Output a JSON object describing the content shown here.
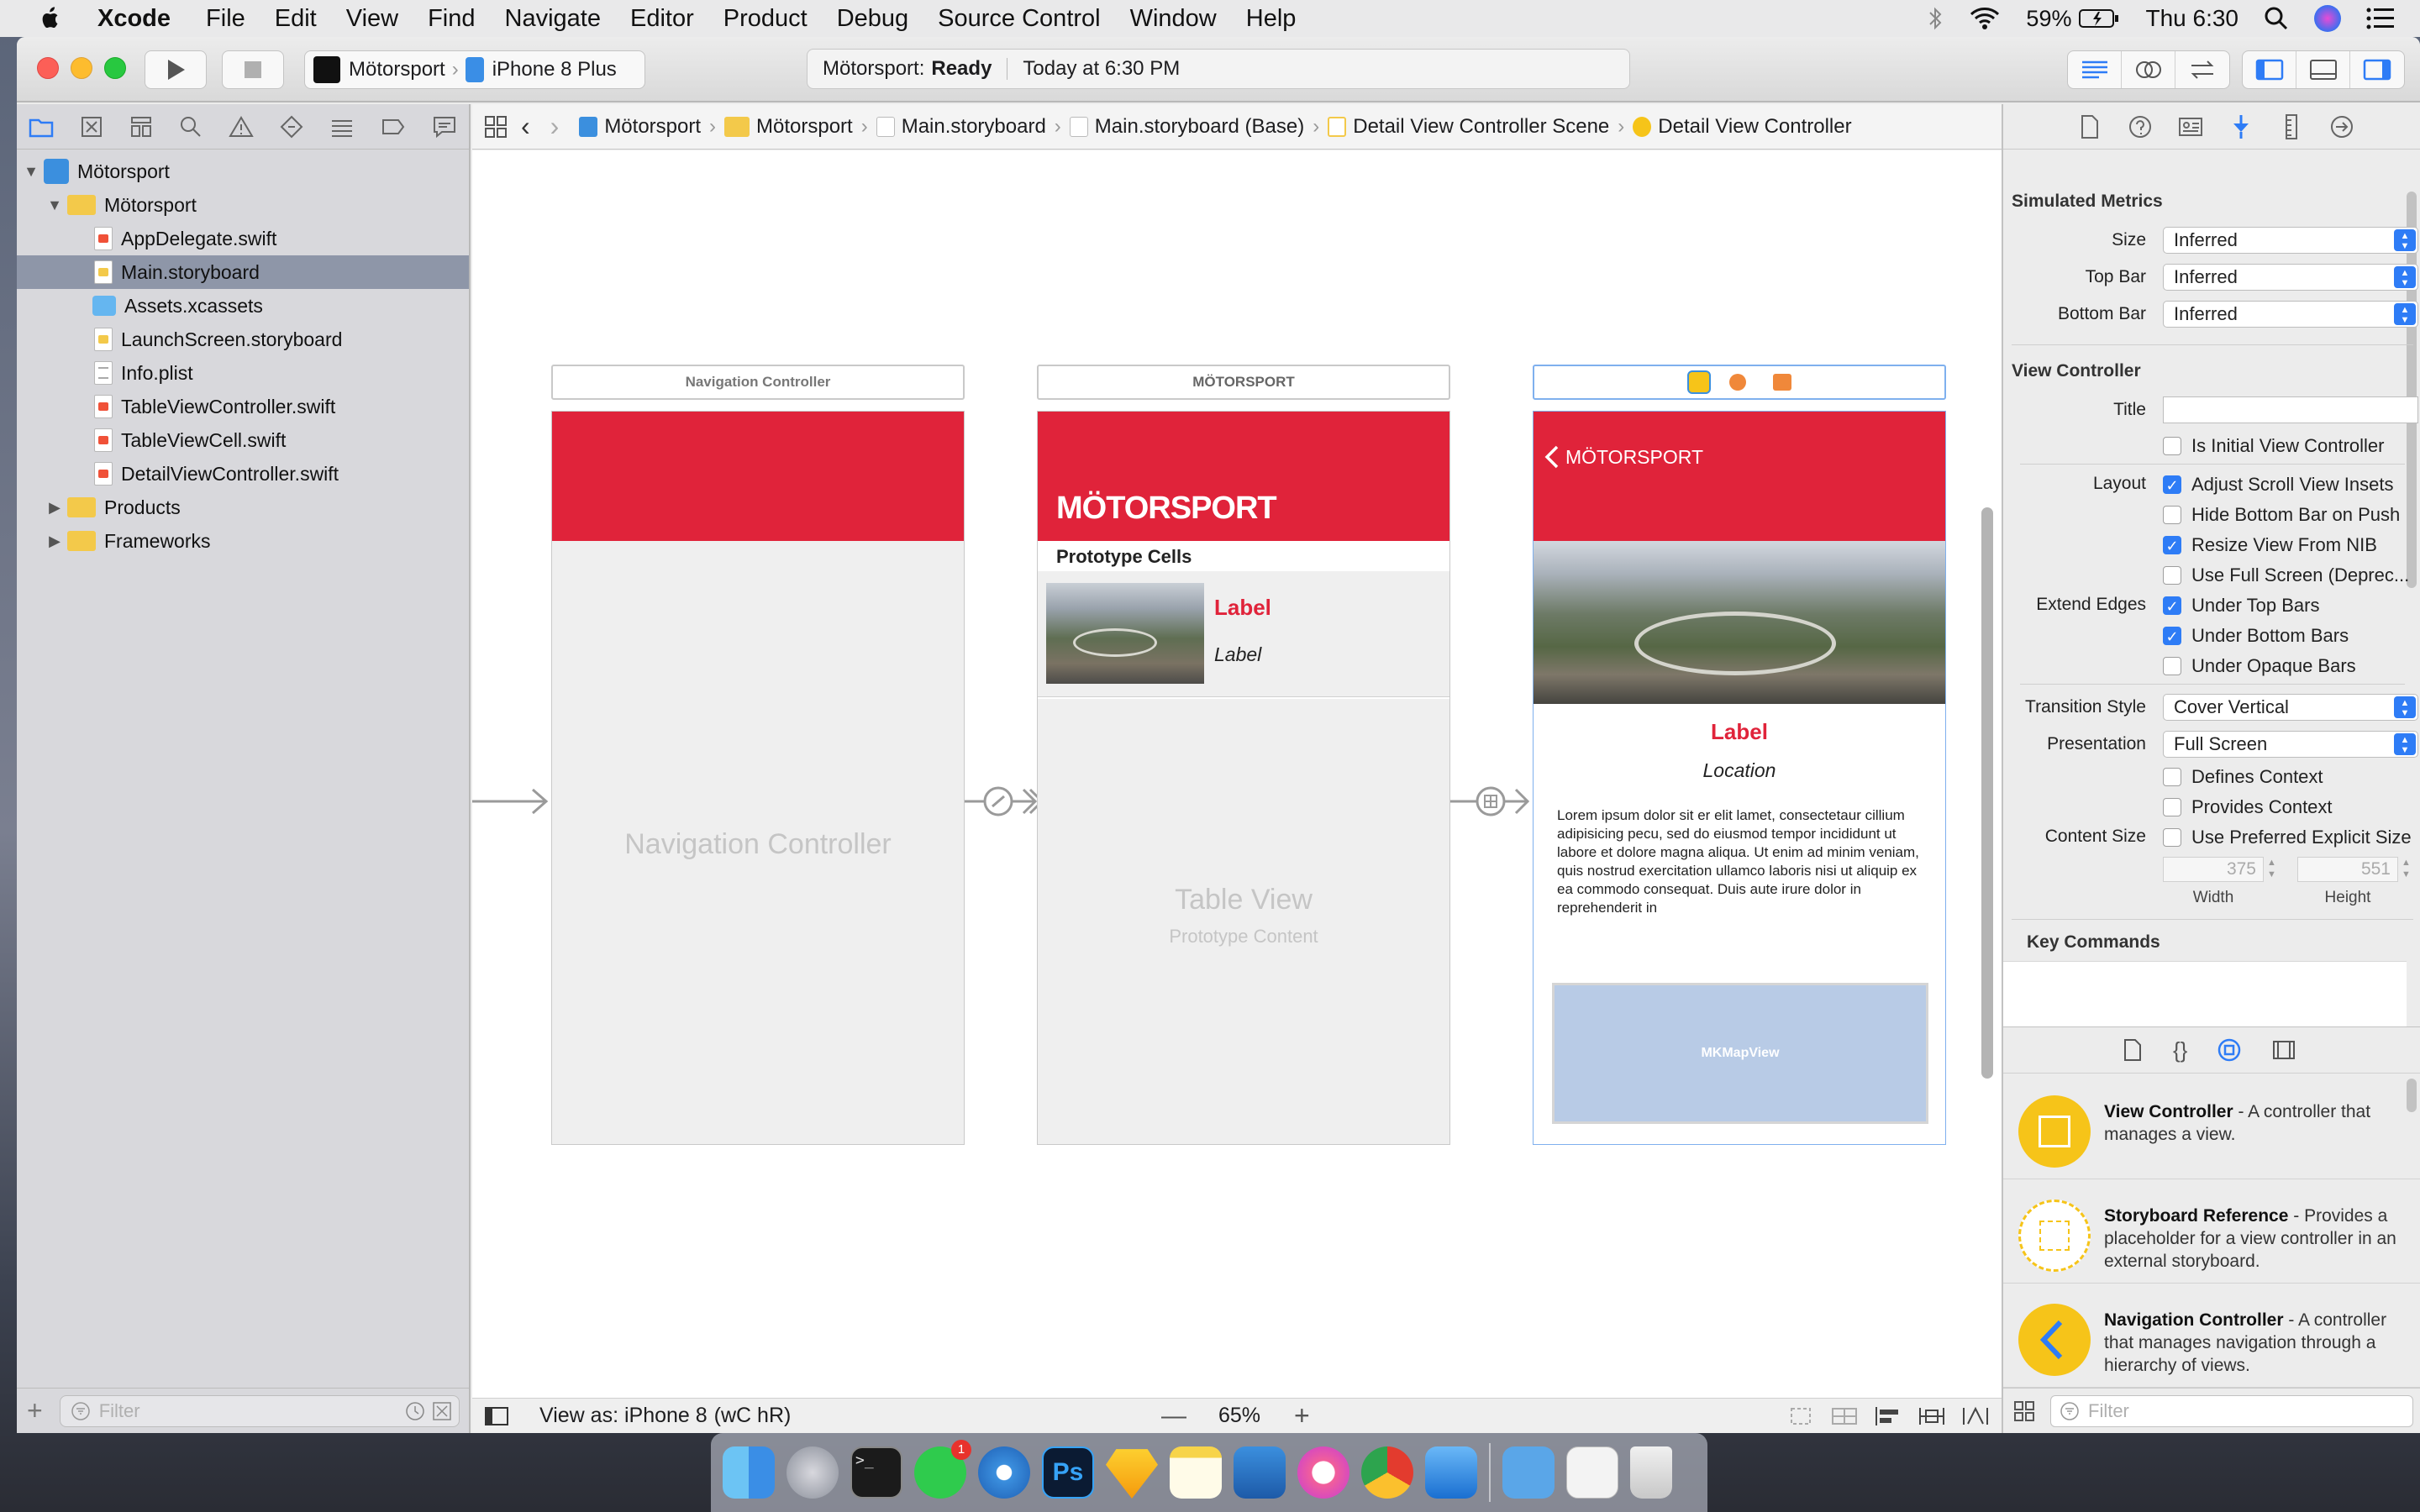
{
  "menubar": {
    "app_name": "Xcode",
    "items": [
      "File",
      "Edit",
      "View",
      "Find",
      "Navigate",
      "Editor",
      "Product",
      "Debug",
      "Source Control",
      "Window",
      "Help"
    ],
    "battery": "59%",
    "clock": "Thu 6:30"
  },
  "toolbar": {
    "scheme": "Mötorsport",
    "device": "iPhone 8 Plus",
    "activity_project": "Mötorsport:",
    "activity_status": "Ready",
    "activity_time": "Today at 6:30 PM"
  },
  "navigator": {
    "items": [
      {
        "label": "Mötorsport",
        "kind": "project"
      },
      {
        "label": "Mötorsport",
        "kind": "folder"
      },
      {
        "label": "AppDelegate.swift",
        "kind": "swift"
      },
      {
        "label": "Main.storyboard",
        "kind": "storyboard"
      },
      {
        "label": "Assets.xcassets",
        "kind": "assets"
      },
      {
        "label": "LaunchScreen.storyboard",
        "kind": "storyboard"
      },
      {
        "label": "Info.plist",
        "kind": "plist"
      },
      {
        "label": "TableViewController.swift",
        "kind": "swift"
      },
      {
        "label": "TableViewCell.swift",
        "kind": "swift"
      },
      {
        "label": "DetailViewController.swift",
        "kind": "swift"
      },
      {
        "label": "Products",
        "kind": "folder"
      },
      {
        "label": "Frameworks",
        "kind": "folder"
      }
    ],
    "filter_placeholder": "Filter"
  },
  "jumpbar": {
    "crumbs": [
      "Mötorsport",
      "Mötorsport",
      "Main.storyboard",
      "Main.storyboard (Base)",
      "Detail View Controller Scene",
      "Detail View Controller"
    ]
  },
  "storyboard": {
    "nav_scene_title": "Navigation Controller",
    "nav_placeholder": "Navigation Controller",
    "table_scene_title": "MÖTORSPORT",
    "table_large_title": "MÖTORSPORT",
    "prototype_cells": "Prototype Cells",
    "cell_title": "Label",
    "cell_subtitle": "Label",
    "table_view_text": "Table View",
    "prototype_content": "Prototype Content",
    "detail_back": "MÖTORSPORT",
    "detail_label": "Label",
    "detail_location": "Location",
    "detail_body": "Lorem ipsum dolor sit er elit lamet, consectetaur cillium adipisicing pecu, sed do eiusmod tempor incididunt ut labore et dolore magna aliqua. Ut enim ad minim veniam, quis nostrud exercitation ullamco laboris nisi ut aliquip ex ea commodo consequat. Duis aute irure dolor in reprehenderit in",
    "map_label": "MKMapView"
  },
  "editor_bottom": {
    "view_as": "View as: iPhone 8",
    "size_class": "(wC hR)",
    "zoom": "65%"
  },
  "inspector": {
    "simulated_metrics": "Simulated Metrics",
    "size_label": "Size",
    "size_value": "Inferred",
    "top_bar_label": "Top Bar",
    "top_bar_value": "Inferred",
    "bottom_bar_label": "Bottom Bar",
    "bottom_bar_value": "Inferred",
    "view_controller": "View Controller",
    "title_label": "Title",
    "initial_vc": "Is Initial View Controller",
    "layout_label": "Layout",
    "adjust_insets": "Adjust Scroll View Insets",
    "hide_bottom_bar": "Hide Bottom Bar on Push",
    "resize_nib": "Resize View From NIB",
    "full_screen": "Use Full Screen (Deprec...",
    "extend_edges_label": "Extend Edges",
    "under_top": "Under Top Bars",
    "under_bottom": "Under Bottom Bars",
    "under_opaque": "Under Opaque Bars",
    "transition_label": "Transition Style",
    "transition_value": "Cover Vertical",
    "presentation_label": "Presentation",
    "presentation_value": "Full Screen",
    "defines_context": "Defines Context",
    "provides_context": "Provides Context",
    "content_size_label": "Content Size",
    "preferred_size": "Use Preferred Explicit Size",
    "width_value": "375",
    "height_value": "551",
    "width_label": "Width",
    "height_label": "Height",
    "key_commands": "Key Commands"
  },
  "library": {
    "items": [
      {
        "title": "View Controller",
        "desc": " - A controller that manages a view."
      },
      {
        "title": "Storyboard Reference",
        "desc": " - Provides a placeholder for a view controller in an external storyboard."
      },
      {
        "title": "Navigation Controller",
        "desc": " - A controller that manages navigation through a hierarchy of views."
      }
    ],
    "filter_placeholder": "Filter"
  },
  "dock": {
    "whatsapp_badge": "1"
  }
}
